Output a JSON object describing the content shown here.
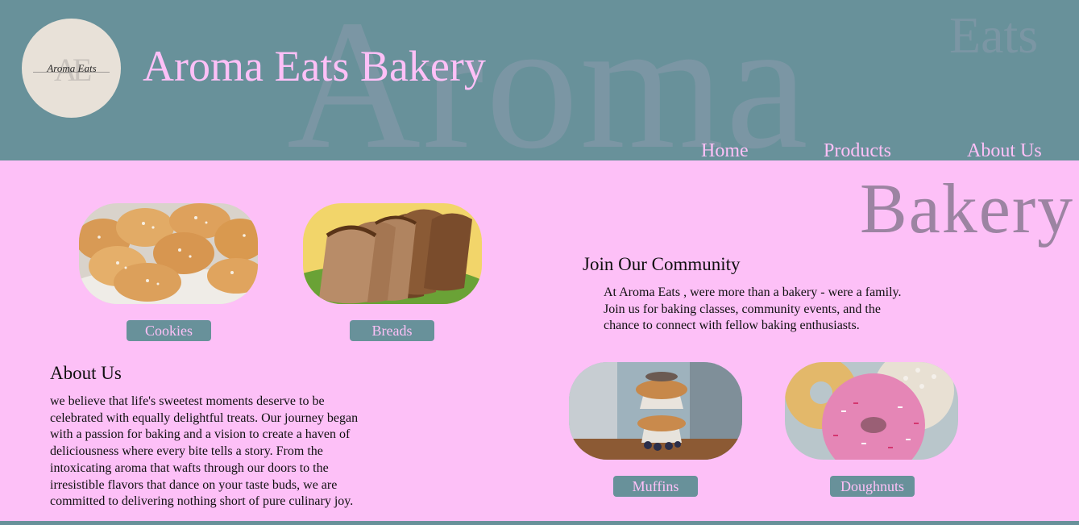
{
  "header": {
    "title": "Aroma Eats Bakery",
    "bg_word_1": "Aroma",
    "bg_word_2": "Eats",
    "logo": {
      "monogram": "AE",
      "script": "Aroma Eats"
    },
    "nav": [
      "Home",
      "Products",
      "About Us"
    ]
  },
  "main": {
    "bg_word_3": "Bakery",
    "products_top": [
      {
        "label": "Cookies",
        "image": "cookies"
      },
      {
        "label": "Breads",
        "image": "bread-slices"
      }
    ],
    "products_bottom": [
      {
        "label": "Muffins",
        "image": "muffins"
      },
      {
        "label": "Doughnuts",
        "image": "doughnuts"
      }
    ],
    "community": {
      "heading": "Join Our Community",
      "text": "At Aroma Eats , were more than a bakery - were a family. Join us for baking classes, community events, and the chance to connect with fellow baking enthusiasts."
    },
    "about": {
      "heading": "About Us",
      "text": "we believe that life's sweetest moments deserve to be celebrated with equally delightful treats. Our journey began with a passion for baking and a vision to create a haven of deliciousness where every bite tells a story. From the intoxicating aroma that wafts through our doors to the irresistible flavors that dance on your taste buds, we are committed to delivering nothing short of pure culinary joy."
    }
  },
  "colors": {
    "primary": "#68919a",
    "background": "#fdc0f7",
    "watermark": "#9c84a2"
  }
}
